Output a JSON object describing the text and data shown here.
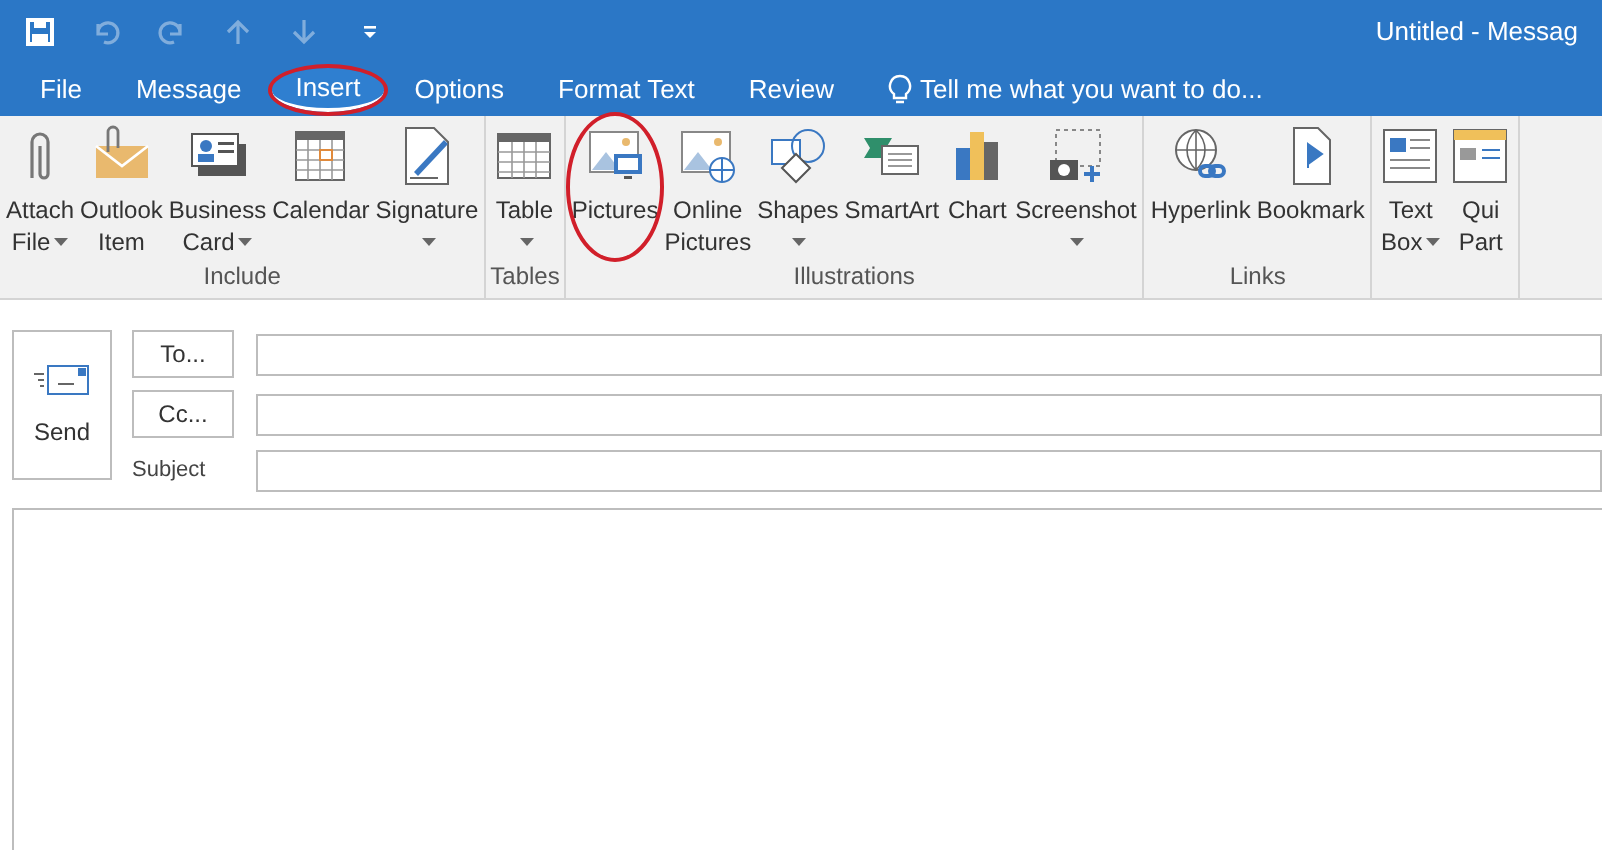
{
  "window": {
    "title": "Untitled - Messag"
  },
  "quick_access": [
    {
      "kind": "save",
      "disabled": false
    },
    {
      "kind": "undo",
      "disabled": true
    },
    {
      "kind": "redo",
      "disabled": true
    },
    {
      "kind": "up",
      "disabled": true
    },
    {
      "kind": "down",
      "disabled": true
    },
    {
      "kind": "customize",
      "disabled": false
    }
  ],
  "tabs": [
    {
      "label": "File",
      "selected": false,
      "circled": false
    },
    {
      "label": "Message",
      "selected": false,
      "circled": false
    },
    {
      "label": "Insert",
      "selected": true,
      "circled": true
    },
    {
      "label": "Options",
      "selected": false,
      "circled": false
    },
    {
      "label": "Format Text",
      "selected": false,
      "circled": false
    },
    {
      "label": "Review",
      "selected": false,
      "circled": false
    }
  ],
  "tell_me": {
    "placeholder": "Tell me what you want to do..."
  },
  "ribbon_groups": [
    {
      "label": "Include",
      "buttons": [
        {
          "kind": "paperclip",
          "lines": [
            "Attach",
            "File"
          ],
          "dropdown": true,
          "circled": false
        },
        {
          "kind": "envelope",
          "lines": [
            "Outlook",
            "Item"
          ],
          "dropdown": false,
          "circled": false
        },
        {
          "kind": "card",
          "lines": [
            "Business",
            "Card"
          ],
          "dropdown": true,
          "circled": false
        },
        {
          "kind": "calendar",
          "lines": [
            "Calendar"
          ],
          "dropdown": false,
          "circled": false
        },
        {
          "kind": "signature",
          "lines": [
            "Signature"
          ],
          "dropdown": true,
          "circled": false
        }
      ]
    },
    {
      "label": "Tables",
      "buttons": [
        {
          "kind": "table",
          "lines": [
            "Table"
          ],
          "dropdown": true,
          "circled": false
        }
      ]
    },
    {
      "label": "Illustrations",
      "buttons": [
        {
          "kind": "pictures",
          "lines": [
            "Pictures"
          ],
          "dropdown": false,
          "circled": true
        },
        {
          "kind": "online",
          "lines": [
            "Online",
            "Pictures"
          ],
          "dropdown": false,
          "circled": false
        },
        {
          "kind": "shapes",
          "lines": [
            "Shapes"
          ],
          "dropdown": true,
          "circled": false
        },
        {
          "kind": "smartart",
          "lines": [
            "SmartArt"
          ],
          "dropdown": false,
          "circled": false
        },
        {
          "kind": "chart",
          "lines": [
            "Chart"
          ],
          "dropdown": false,
          "circled": false
        },
        {
          "kind": "screenshot",
          "lines": [
            "Screenshot"
          ],
          "dropdown": true,
          "circled": false
        }
      ]
    },
    {
      "label": "Links",
      "buttons": [
        {
          "kind": "hyperlink",
          "lines": [
            "Hyperlink"
          ],
          "dropdown": false,
          "circled": false
        },
        {
          "kind": "bookmark",
          "lines": [
            "Bookmark"
          ],
          "dropdown": false,
          "circled": false
        }
      ]
    },
    {
      "buttons": [
        {
          "kind": "textbox",
          "lines": [
            "Text",
            "Box"
          ],
          "dropdown": true,
          "circled": false
        },
        {
          "kind": "quickparts",
          "lines": [
            "Qui",
            "Part"
          ],
          "dropdown": false,
          "circled": false
        }
      ]
    }
  ],
  "compose": {
    "send": "Send",
    "to": "To...",
    "cc": "Cc...",
    "subject_label": "Subject"
  }
}
